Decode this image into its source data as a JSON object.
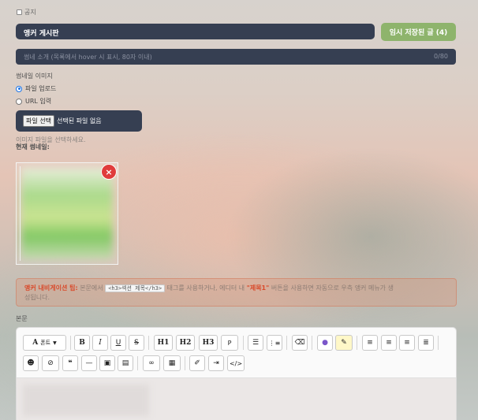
{
  "notice_checkbox": {
    "label": "공지",
    "checked": false
  },
  "title_input": {
    "value": "앵커 게시판"
  },
  "draft_button": {
    "label": "임시 저장된 글 (4)"
  },
  "description_input": {
    "placeholder": "썸네 소개 (목록에서 hover 시 표시, 80자 이내)",
    "counter": "0/80"
  },
  "thumbnail": {
    "section_label": "썸네일 이미지",
    "options": [
      {
        "label": "파일 업로드",
        "selected": true
      },
      {
        "label": "URL 입력",
        "selected": false
      }
    ],
    "file_button": "파일 선택",
    "file_status": "선택된 파일 없음",
    "hint": "이미지 파일을 선택하세요.",
    "current_label": "현재 썸네일:"
  },
  "tip": {
    "prefix": "앵커 내비게이션 팁:",
    "text1": " 본문에서 ",
    "code": "<h3>섹션 제목</h3>",
    "text2": " 태그를 사용하거나, 에디터 내 ",
    "highlight": "\"제목1\"",
    "text3": " 버튼을 사용하면 자동으로 우측 앵커 메뉴가 생",
    "line2": "성됩니다."
  },
  "body_label": "본문",
  "toolbar": {
    "font_label": "폰트",
    "buttons_row1": [
      "B",
      "I",
      "U",
      "S",
      "H1",
      "H2",
      "H3",
      "P"
    ],
    "buttons_row2": []
  },
  "colors": {
    "accent_dark": "#363f52",
    "draft_green": "#8eb46c",
    "danger": "#e03c3c",
    "tip_red": "#d94a2b"
  }
}
